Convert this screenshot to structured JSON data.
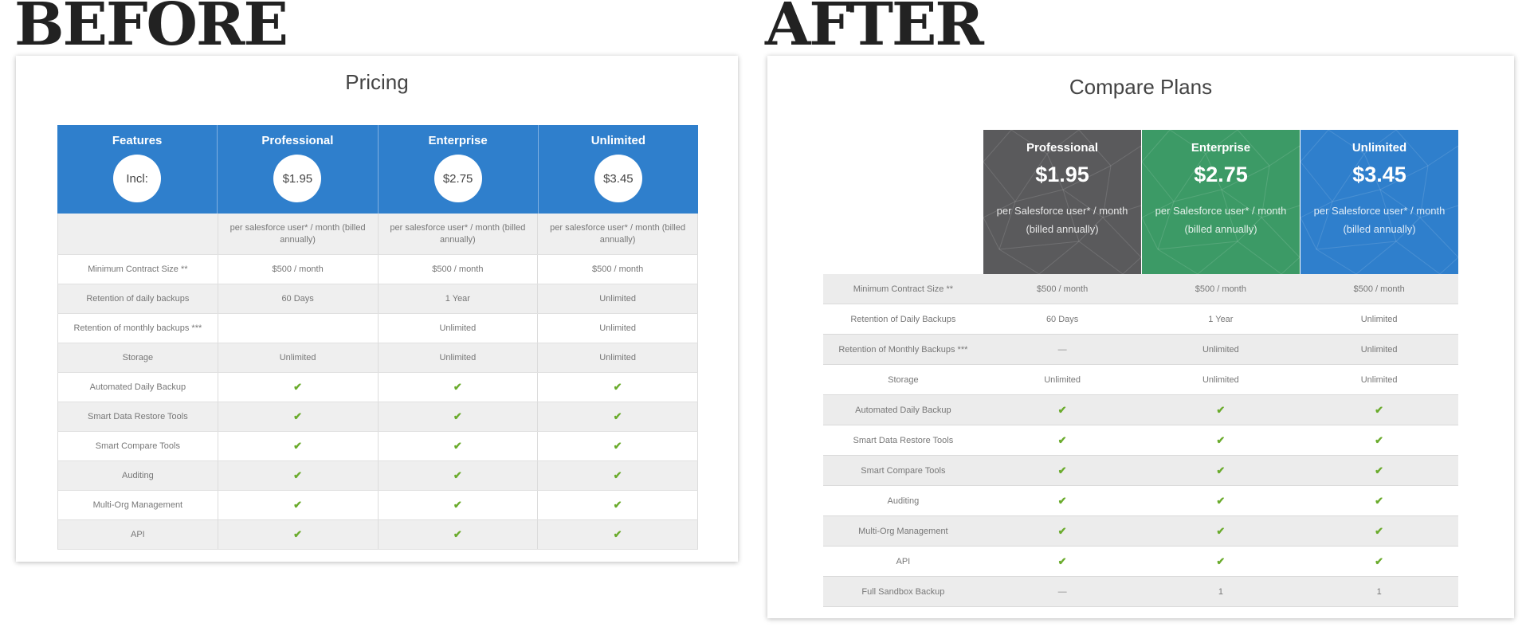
{
  "before": {
    "heading": "BEFORE",
    "title": "Pricing",
    "header": [
      {
        "name": "Features",
        "badge": "Incl:"
      },
      {
        "name": "Professional",
        "badge": "$1.95"
      },
      {
        "name": "Enterprise",
        "badge": "$2.75"
      },
      {
        "name": "Unlimited",
        "badge": "$3.45"
      }
    ],
    "billing_row": [
      "",
      "per salesforce user* / month (billed annually)",
      "per salesforce user* / month (billed annually)",
      "per salesforce user* / month (billed annually)"
    ],
    "rows": [
      [
        "Minimum Contract Size **",
        "$500 / month",
        "$500 / month",
        "$500 / month"
      ],
      [
        "Retention of daily backups",
        "60 Days",
        "1 Year",
        "Unlimited"
      ],
      [
        "Retention of monthly backups ***",
        "",
        "Unlimited",
        "Unlimited"
      ],
      [
        "Storage",
        "Unlimited",
        "Unlimited",
        "Unlimited"
      ],
      [
        "Automated Daily Backup",
        "✔",
        "✔",
        "✔"
      ],
      [
        "Smart Data Restore Tools",
        "✔",
        "✔",
        "✔"
      ],
      [
        "Smart Compare Tools",
        "✔",
        "✔",
        "✔"
      ],
      [
        "Auditing",
        "✔",
        "✔",
        "✔"
      ],
      [
        "Multi-Org Management",
        "✔",
        "✔",
        "✔"
      ],
      [
        "API",
        "✔",
        "✔",
        "✔"
      ]
    ]
  },
  "after": {
    "heading": "AFTER",
    "title": "Compare Plans",
    "plans": [
      {
        "name": "Professional",
        "price": "$1.95",
        "note1": "per Salesforce user* / month",
        "note2": "(billed annually)",
        "color": "#5a5a5c"
      },
      {
        "name": "Enterprise",
        "price": "$2.75",
        "note1": "per Salesforce user* / month",
        "note2": "(billed annually)",
        "color": "#3c9a66"
      },
      {
        "name": "Unlimited",
        "price": "$3.45",
        "note1": "per Salesforce user* / month",
        "note2": "(billed annually)",
        "color": "#2f7fcc"
      }
    ],
    "rows": [
      [
        "Minimum Contract Size **",
        "$500 / month",
        "$500 / month",
        "$500 / month"
      ],
      [
        "Retention of Daily Backups",
        "60 Days",
        "1 Year",
        "Unlimited"
      ],
      [
        "Retention of Monthly Backups ***",
        "—",
        "Unlimited",
        "Unlimited"
      ],
      [
        "Storage",
        "Unlimited",
        "Unlimited",
        "Unlimited"
      ],
      [
        "Automated Daily Backup",
        "✔",
        "✔",
        "✔"
      ],
      [
        "Smart Data Restore Tools",
        "✔",
        "✔",
        "✔"
      ],
      [
        "Smart Compare Tools",
        "✔",
        "✔",
        "✔"
      ],
      [
        "Auditing",
        "✔",
        "✔",
        "✔"
      ],
      [
        "Multi-Org Management",
        "✔",
        "✔",
        "✔"
      ],
      [
        "API",
        "✔",
        "✔",
        "✔"
      ],
      [
        "Full Sandbox Backup",
        "—",
        "1",
        "1"
      ]
    ]
  },
  "colors": {
    "before_header": "#2f7fcc",
    "check": "#6aab2c"
  }
}
